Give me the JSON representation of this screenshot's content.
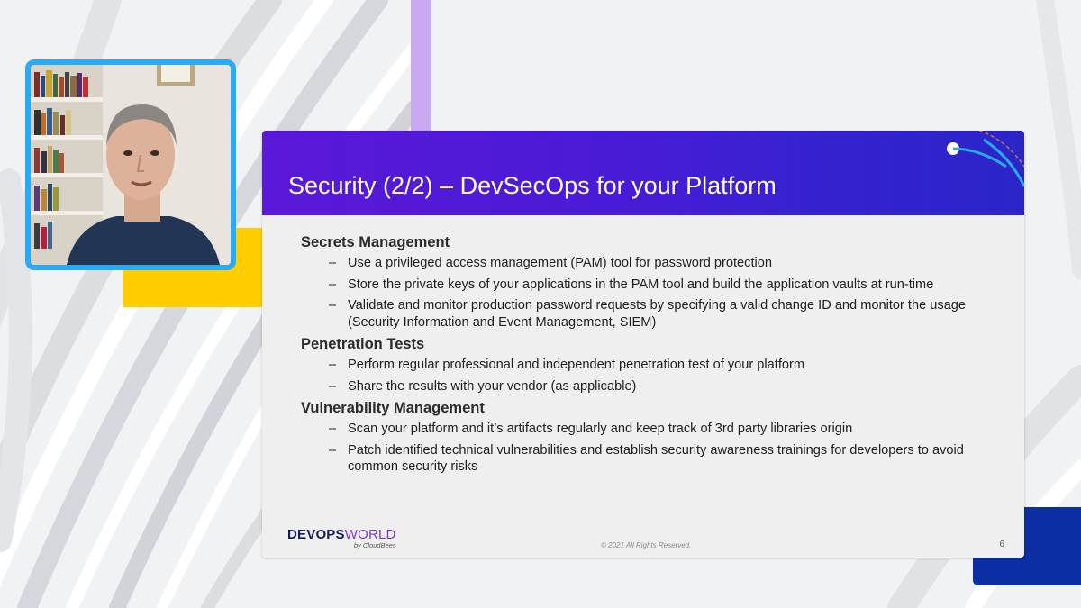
{
  "slide": {
    "title": "Security (2/2) – DevSecOps for your Platform",
    "sections": [
      {
        "heading": "Secrets Management",
        "bullets": [
          "Use a privileged access management (PAM) tool for password protection",
          "Store the private keys of your applications in the PAM tool and build the application vaults at run-time",
          "Validate and monitor production password requests by specifying a valid change ID and monitor the usage (Security Information and Event Management, SIEM)"
        ]
      },
      {
        "heading": "Penetration Tests",
        "bullets": [
          "Perform regular professional and independent penetration test of your platform",
          "Share the results with your vendor (as applicable)"
        ]
      },
      {
        "heading": "Vulnerability Management",
        "bullets": [
          "Scan your platform and it’s artifacts regularly and keep track of 3rd party libraries origin",
          "Patch identified technical vulnerabilities and establish security awareness trainings for developers to avoid common security risks"
        ]
      }
    ],
    "bullet_marker": "–",
    "logo": {
      "main_bold": "DEVOPS",
      "main_thin": "WORLD",
      "sub": "by CloudBees"
    },
    "copyright": "© 2021 All Rights Reserved.",
    "page_number": "6"
  },
  "colors": {
    "header_gradient_start": "#5a18d8",
    "header_gradient_end": "#2b25c8",
    "webcam_border": "#2aa9f5",
    "yellow_accent": "#ffcd00",
    "purple_accent": "#c9a9ef",
    "blue_accent": "#0b2fa3"
  }
}
